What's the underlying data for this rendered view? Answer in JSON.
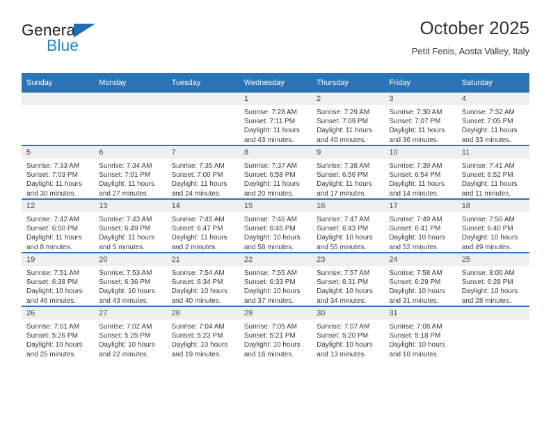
{
  "brand": {
    "name_top": "General",
    "name_bottom": "Blue",
    "triangle_color": "#1f6fb5",
    "blue_text_color": "#1f88d4"
  },
  "header": {
    "title": "October 2025",
    "subtitle": "Petit Fenis, Aosta Valley, Italy"
  },
  "theme": {
    "header_bar": "#2b74b8",
    "daynum_band": "#efefef",
    "text": "#333333"
  },
  "weekday_headers": [
    "Sunday",
    "Monday",
    "Tuesday",
    "Wednesday",
    "Thursday",
    "Friday",
    "Saturday"
  ],
  "labels": {
    "sunrise_prefix": "Sunrise: ",
    "sunset_prefix": "Sunset: ",
    "daylight_prefix": "Daylight: "
  },
  "weeks": [
    [
      {
        "day": "",
        "empty": true
      },
      {
        "day": "",
        "empty": true
      },
      {
        "day": "",
        "empty": true
      },
      {
        "day": "1",
        "sunrise": "Sunrise: 7:28 AM",
        "sunset": "Sunset: 7:11 PM",
        "daylight_1": "Daylight: 11 hours",
        "daylight_2": "and 43 minutes."
      },
      {
        "day": "2",
        "sunrise": "Sunrise: 7:29 AM",
        "sunset": "Sunset: 7:09 PM",
        "daylight_1": "Daylight: 11 hours",
        "daylight_2": "and 40 minutes."
      },
      {
        "day": "3",
        "sunrise": "Sunrise: 7:30 AM",
        "sunset": "Sunset: 7:07 PM",
        "daylight_1": "Daylight: 11 hours",
        "daylight_2": "and 36 minutes."
      },
      {
        "day": "4",
        "sunrise": "Sunrise: 7:32 AM",
        "sunset": "Sunset: 7:05 PM",
        "daylight_1": "Daylight: 11 hours",
        "daylight_2": "and 33 minutes."
      }
    ],
    [
      {
        "day": "5",
        "sunrise": "Sunrise: 7:33 AM",
        "sunset": "Sunset: 7:03 PM",
        "daylight_1": "Daylight: 11 hours",
        "daylight_2": "and 30 minutes."
      },
      {
        "day": "6",
        "sunrise": "Sunrise: 7:34 AM",
        "sunset": "Sunset: 7:01 PM",
        "daylight_1": "Daylight: 11 hours",
        "daylight_2": "and 27 minutes."
      },
      {
        "day": "7",
        "sunrise": "Sunrise: 7:35 AM",
        "sunset": "Sunset: 7:00 PM",
        "daylight_1": "Daylight: 11 hours",
        "daylight_2": "and 24 minutes."
      },
      {
        "day": "8",
        "sunrise": "Sunrise: 7:37 AM",
        "sunset": "Sunset: 6:58 PM",
        "daylight_1": "Daylight: 11 hours",
        "daylight_2": "and 20 minutes."
      },
      {
        "day": "9",
        "sunrise": "Sunrise: 7:38 AM",
        "sunset": "Sunset: 6:56 PM",
        "daylight_1": "Daylight: 11 hours",
        "daylight_2": "and 17 minutes."
      },
      {
        "day": "10",
        "sunrise": "Sunrise: 7:39 AM",
        "sunset": "Sunset: 6:54 PM",
        "daylight_1": "Daylight: 11 hours",
        "daylight_2": "and 14 minutes."
      },
      {
        "day": "11",
        "sunrise": "Sunrise: 7:41 AM",
        "sunset": "Sunset: 6:52 PM",
        "daylight_1": "Daylight: 11 hours",
        "daylight_2": "and 11 minutes."
      }
    ],
    [
      {
        "day": "12",
        "sunrise": "Sunrise: 7:42 AM",
        "sunset": "Sunset: 6:50 PM",
        "daylight_1": "Daylight: 11 hours",
        "daylight_2": "and 8 minutes."
      },
      {
        "day": "13",
        "sunrise": "Sunrise: 7:43 AM",
        "sunset": "Sunset: 6:49 PM",
        "daylight_1": "Daylight: 11 hours",
        "daylight_2": "and 5 minutes."
      },
      {
        "day": "14",
        "sunrise": "Sunrise: 7:45 AM",
        "sunset": "Sunset: 6:47 PM",
        "daylight_1": "Daylight: 11 hours",
        "daylight_2": "and 2 minutes."
      },
      {
        "day": "15",
        "sunrise": "Sunrise: 7:46 AM",
        "sunset": "Sunset: 6:45 PM",
        "daylight_1": "Daylight: 10 hours",
        "daylight_2": "and 58 minutes."
      },
      {
        "day": "16",
        "sunrise": "Sunrise: 7:47 AM",
        "sunset": "Sunset: 6:43 PM",
        "daylight_1": "Daylight: 10 hours",
        "daylight_2": "and 55 minutes."
      },
      {
        "day": "17",
        "sunrise": "Sunrise: 7:49 AM",
        "sunset": "Sunset: 6:41 PM",
        "daylight_1": "Daylight: 10 hours",
        "daylight_2": "and 52 minutes."
      },
      {
        "day": "18",
        "sunrise": "Sunrise: 7:50 AM",
        "sunset": "Sunset: 6:40 PM",
        "daylight_1": "Daylight: 10 hours",
        "daylight_2": "and 49 minutes."
      }
    ],
    [
      {
        "day": "19",
        "sunrise": "Sunrise: 7:51 AM",
        "sunset": "Sunset: 6:38 PM",
        "daylight_1": "Daylight: 10 hours",
        "daylight_2": "and 46 minutes."
      },
      {
        "day": "20",
        "sunrise": "Sunrise: 7:53 AM",
        "sunset": "Sunset: 6:36 PM",
        "daylight_1": "Daylight: 10 hours",
        "daylight_2": "and 43 minutes."
      },
      {
        "day": "21",
        "sunrise": "Sunrise: 7:54 AM",
        "sunset": "Sunset: 6:34 PM",
        "daylight_1": "Daylight: 10 hours",
        "daylight_2": "and 40 minutes."
      },
      {
        "day": "22",
        "sunrise": "Sunrise: 7:55 AM",
        "sunset": "Sunset: 6:33 PM",
        "daylight_1": "Daylight: 10 hours",
        "daylight_2": "and 37 minutes."
      },
      {
        "day": "23",
        "sunrise": "Sunrise: 7:57 AM",
        "sunset": "Sunset: 6:31 PM",
        "daylight_1": "Daylight: 10 hours",
        "daylight_2": "and 34 minutes."
      },
      {
        "day": "24",
        "sunrise": "Sunrise: 7:58 AM",
        "sunset": "Sunset: 6:29 PM",
        "daylight_1": "Daylight: 10 hours",
        "daylight_2": "and 31 minutes."
      },
      {
        "day": "25",
        "sunrise": "Sunrise: 8:00 AM",
        "sunset": "Sunset: 6:28 PM",
        "daylight_1": "Daylight: 10 hours",
        "daylight_2": "and 28 minutes."
      }
    ],
    [
      {
        "day": "26",
        "sunrise": "Sunrise: 7:01 AM",
        "sunset": "Sunset: 5:26 PM",
        "daylight_1": "Daylight: 10 hours",
        "daylight_2": "and 25 minutes."
      },
      {
        "day": "27",
        "sunrise": "Sunrise: 7:02 AM",
        "sunset": "Sunset: 5:25 PM",
        "daylight_1": "Daylight: 10 hours",
        "daylight_2": "and 22 minutes."
      },
      {
        "day": "28",
        "sunrise": "Sunrise: 7:04 AM",
        "sunset": "Sunset: 5:23 PM",
        "daylight_1": "Daylight: 10 hours",
        "daylight_2": "and 19 minutes."
      },
      {
        "day": "29",
        "sunrise": "Sunrise: 7:05 AM",
        "sunset": "Sunset: 5:21 PM",
        "daylight_1": "Daylight: 10 hours",
        "daylight_2": "and 16 minutes."
      },
      {
        "day": "30",
        "sunrise": "Sunrise: 7:07 AM",
        "sunset": "Sunset: 5:20 PM",
        "daylight_1": "Daylight: 10 hours",
        "daylight_2": "and 13 minutes."
      },
      {
        "day": "31",
        "sunrise": "Sunrise: 7:08 AM",
        "sunset": "Sunset: 5:18 PM",
        "daylight_1": "Daylight: 10 hours",
        "daylight_2": "and 10 minutes."
      },
      {
        "day": "",
        "empty": true
      }
    ]
  ]
}
